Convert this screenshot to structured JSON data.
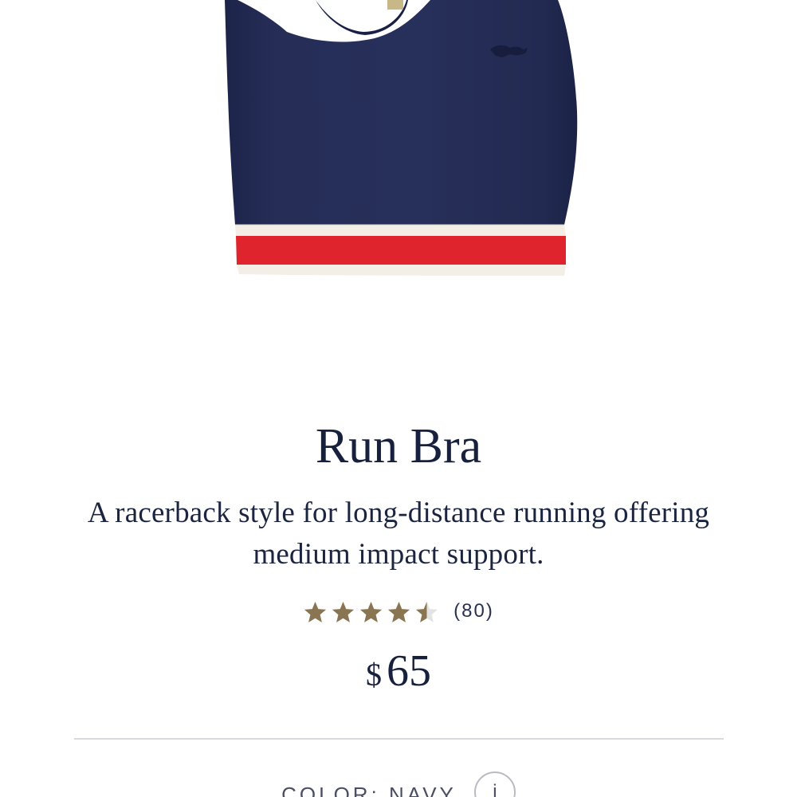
{
  "product": {
    "image_alt": "Navy racerback sports bra with red and cream striped band",
    "title": "Run Bra",
    "description": "A racerback style for long-distance running offering medium impact support.",
    "rating": {
      "value": 4.5,
      "max": 5,
      "count_label": "(80)"
    },
    "price": {
      "currency": "$",
      "amount": "65"
    },
    "color": {
      "label": "COLOR: NAVY",
      "info_label": "i"
    }
  },
  "colors": {
    "navy": "#232a52",
    "stripe_red": "#e0242e",
    "stripe_cream": "#f3efe6",
    "star_gold": "#8a7552",
    "star_empty": "#e3e3e3",
    "text": "#17213d"
  },
  "icons": {
    "star": "star-icon",
    "info": "info-icon"
  }
}
